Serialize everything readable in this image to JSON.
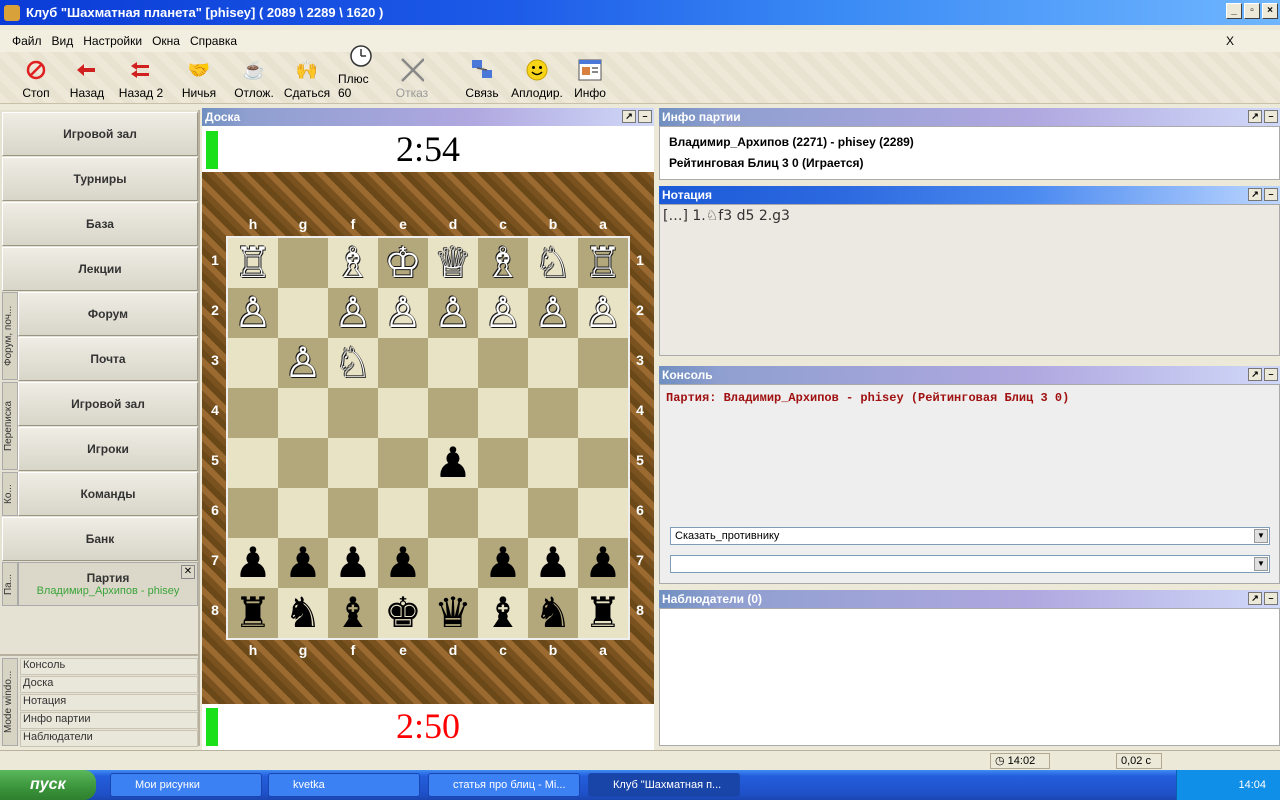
{
  "window": {
    "title": "Клуб \"Шахматная планета\" [phisey]  ( 2089 \\ 2289 \\ 1620 )"
  },
  "menu": [
    "Файл",
    "Вид",
    "Настройки",
    "Окна",
    "Справка"
  ],
  "menu_close": "X",
  "toolbar": [
    {
      "label": "Стоп",
      "icon": "stop-icon"
    },
    {
      "label": "Назад",
      "icon": "back-arrow-icon"
    },
    {
      "label": "Назад 2",
      "icon": "double-back-arrow-icon"
    },
    {
      "label": "Ничья",
      "icon": "handshake-icon"
    },
    {
      "label": "Отлож.",
      "icon": "postpone-icon"
    },
    {
      "label": "Сдаться",
      "icon": "surrender-hands-icon"
    },
    {
      "label": "Плюс 60",
      "icon": "clock-icon"
    },
    {
      "label": "Отказ",
      "icon": "x-cross-icon",
      "disabled": true
    },
    {
      "label": "Связь",
      "icon": "network-icon"
    },
    {
      "label": "Аплодир.",
      "icon": "smiley-icon"
    },
    {
      "label": "Инфо",
      "icon": "info-window-icon"
    }
  ],
  "left_nav": {
    "items": [
      "Игровой зал",
      "Турниры",
      "База",
      "Лекции",
      "Форум",
      "Почта",
      "Игровой зал",
      "Игроки",
      "Команды",
      "Банк"
    ],
    "vertical_tabs": [
      "Форум, поч...",
      "Переписка",
      "Ко...",
      "Па..."
    ],
    "party_title": "Партия",
    "party_subtitle": "Владимир_Архипов - phisey",
    "mode_tab": "Mode windo...",
    "mode_items": [
      "Консоль",
      "Доска",
      "Нотация",
      "Инфо партии",
      "Наблюдатели"
    ]
  },
  "board": {
    "panel_title": "Доска",
    "top_clock": "2:54",
    "bottom_clock": "2:50",
    "bottom_clock_color": "#ff0000",
    "files": [
      "h",
      "g",
      "f",
      "e",
      "d",
      "c",
      "b",
      "a"
    ],
    "ranks": [
      "1",
      "2",
      "3",
      "4",
      "5",
      "6",
      "7",
      "8"
    ],
    "rows": [
      [
        "♖",
        "",
        "♗",
        "♔",
        "♕",
        "♗",
        "♘",
        "♖"
      ],
      [
        "♙",
        "",
        "♙",
        "♙",
        "♙",
        "♙",
        "♙",
        "♙"
      ],
      [
        "",
        "♙",
        "♘",
        "",
        "",
        "",
        "",
        ""
      ],
      [
        "",
        "",
        "",
        "",
        "",
        "",
        "",
        ""
      ],
      [
        "",
        "",
        "",
        "",
        "♟",
        "",
        "",
        ""
      ],
      [
        "",
        "",
        "",
        "",
        "",
        "",
        "",
        ""
      ],
      [
        "♟",
        "♟",
        "♟",
        "♟",
        "",
        "♟",
        "♟",
        "♟"
      ],
      [
        "♜",
        "♞",
        "♝",
        "♚",
        "♛",
        "♝",
        "♞",
        "♜"
      ]
    ]
  },
  "game_info": {
    "panel_title": "Инфо партии",
    "players": "Владимир_Архипов (2271) - phisey (2289)",
    "type": "Рейтинговая Блиц 3 0  (Играется)"
  },
  "notation": {
    "panel_title": "Нотация",
    "moves": "[…] 1.♘f3 d5 2.g3"
  },
  "console": {
    "panel_title": "Консоль",
    "message": "Партия: Владимир_Архипов - phisey (Рейтинговая Блиц 3 0)",
    "say_select": "Сказать_противнику",
    "input_value": ""
  },
  "observers": {
    "panel_title": "Наблюдатели (0)"
  },
  "status": {
    "time": "14:02",
    "lag": "0,02 с"
  },
  "taskbar": {
    "start": "пуск",
    "tasks": [
      "Мои рисунки",
      "kvetka",
      "статья про блиц - Mi...",
      "Клуб \"Шахматная п..."
    ],
    "clock": "14:04"
  }
}
